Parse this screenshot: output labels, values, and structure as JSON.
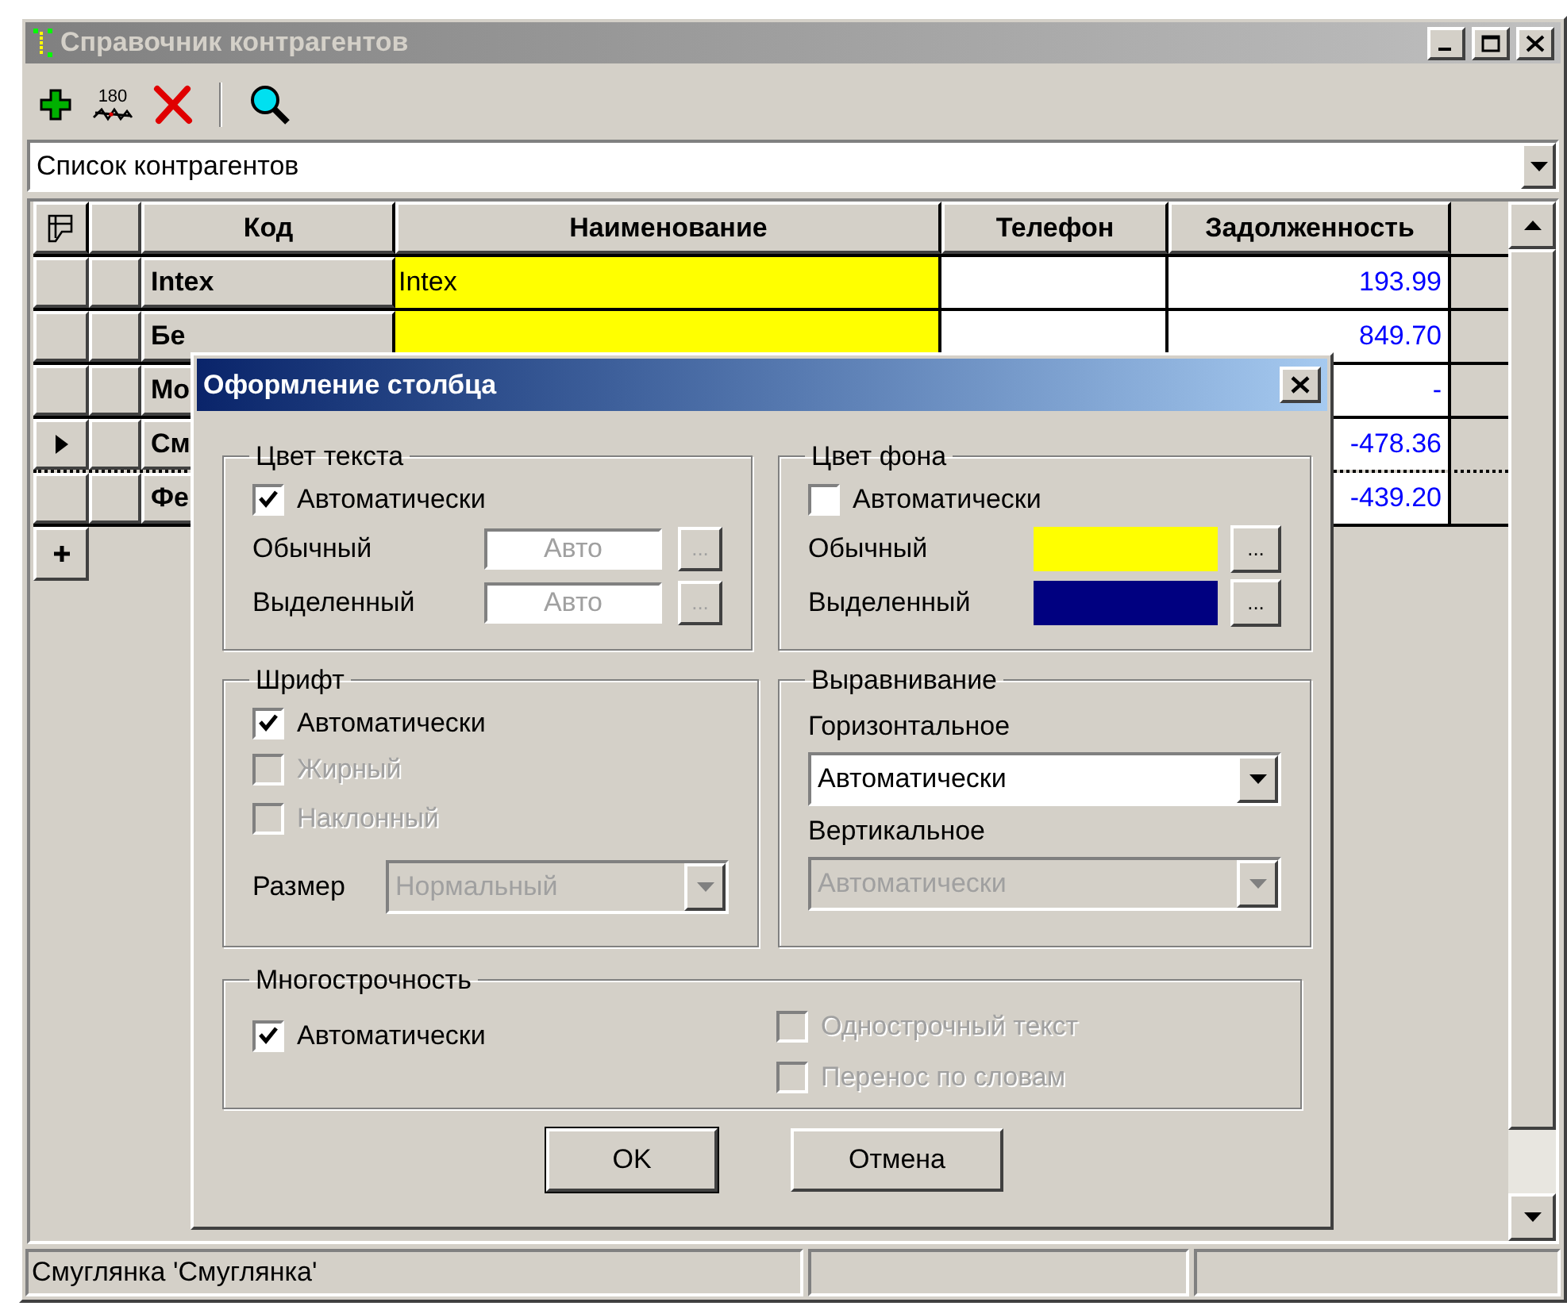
{
  "window": {
    "title": "Справочник контрагентов",
    "active": false
  },
  "toolbar": [
    {
      "kind": "add"
    },
    {
      "kind": "numbers",
      "label": "180"
    },
    {
      "kind": "delete"
    },
    {
      "kind": "separator"
    },
    {
      "kind": "search"
    }
  ],
  "list_selector": {
    "value": "Список контрагентов"
  },
  "grid": {
    "columns": [
      "Код",
      "Наименование",
      "Телефон",
      "Задолженность"
    ],
    "rows": [
      {
        "code": "Intex",
        "name": "Intex",
        "color": "#ffff00",
        "debt": "193.99",
        "current": false
      },
      {
        "code": "Бе",
        "color": "#ffff00",
        "debt": "849.70",
        "current": false
      },
      {
        "code": "Мо",
        "debt": "-",
        "current": false
      },
      {
        "code": "См",
        "debt": "-478.36",
        "current": true
      },
      {
        "code": "Фе",
        "debt": "-439.20",
        "current": false
      }
    ]
  },
  "dialog": {
    "title": "Оформление столбца",
    "text_color": {
      "title": "Цвет текста",
      "auto": {
        "label": "Автоматически",
        "checked": true
      },
      "rows": [
        {
          "label": "Обычный",
          "value": "Авто",
          "button": "...",
          "disabled": true
        },
        {
          "label": "Выделенный",
          "value": "Авто",
          "button": "...",
          "disabled": true
        }
      ]
    },
    "background": {
      "title": "Цвет фона",
      "auto": {
        "label": "Автоматически",
        "checked": false
      },
      "rows": [
        {
          "label": "Обычный",
          "color": "#ffff00",
          "button": "..."
        },
        {
          "label": "Выделенный",
          "color": "#000080",
          "button": "..."
        }
      ]
    },
    "font": {
      "title": "Шрифт",
      "options": [
        {
          "label": "Автоматически",
          "checked": true,
          "disabled": false
        },
        {
          "label": "Жирный",
          "checked": false,
          "disabled": true
        },
        {
          "label": "Наклонный",
          "checked": false,
          "disabled": true
        }
      ],
      "size": {
        "label": "Размер",
        "value": "Нормальный",
        "disabled": true
      }
    },
    "alignment": {
      "title": "Выравнивание",
      "fields": [
        {
          "label": "Горизонтальное",
          "value": "Автоматически",
          "disabled": false
        },
        {
          "label": "Вертикальное",
          "value": "Автоматически",
          "disabled": true
        }
      ]
    },
    "multiline": {
      "title": "Многострочность",
      "auto": {
        "label": "Автоматически",
        "checked": true,
        "disabled": false
      },
      "options": [
        {
          "label": "Однострочный текст",
          "checked": false,
          "disabled": true
        },
        {
          "label": "Перенос по словам",
          "checked": false,
          "disabled": true
        }
      ]
    },
    "buttons": [
      {
        "label": "OK",
        "default": true
      },
      {
        "label": "Отмена",
        "default": false
      }
    ]
  },
  "status_bar": [
    "Смуглянка 'Смуглянка'"
  ]
}
